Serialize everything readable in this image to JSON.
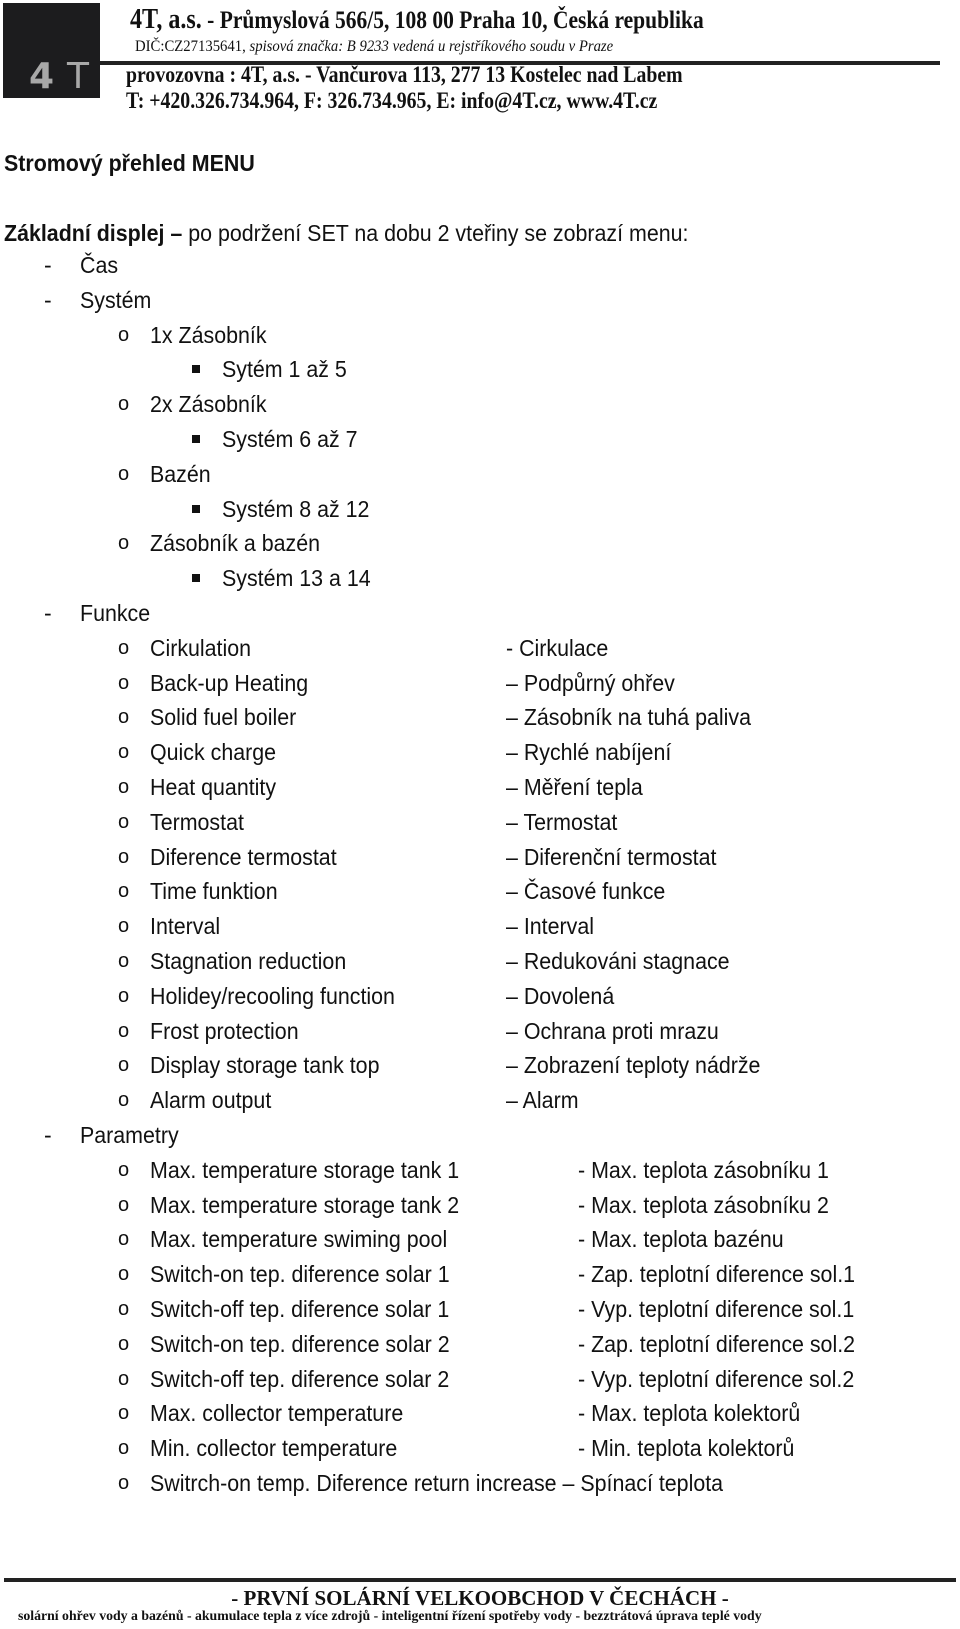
{
  "letterhead": {
    "logo_text_a": "4",
    "logo_text_b": "T",
    "company_bold": "4T, a.s.",
    "line1_rest": " - Průmyslová 566/5, 108 00 Praha 10, Česká republika",
    "line2_dic": "DIČ:CZ27135641, ",
    "line2_italic": "spisová značka: B 9233 vedená u rejstříkového soudu v Praze",
    "line3": "provozovna : 4T, a.s. - Vančurova 113, 277 13 Kostelec nad Labem",
    "line4": "T: +420.326.734.964, F: 326.734.965, E: info@4T.cz, www.4T.cz"
  },
  "document": {
    "title": "Stromový přehled MENU",
    "intro_bold": "Základní displej –",
    "intro_rest": " po podržení SET na dobu 2 vteřiny se zobrazí menu:",
    "menu": {
      "cas": {
        "bullet": "-",
        "label": "Čas"
      },
      "system": {
        "bullet": "-",
        "label": "Systém",
        "children": [
          {
            "bullet": "o",
            "label": "1x Zásobník",
            "sub": "Sytém 1 až 5"
          },
          {
            "bullet": "o",
            "label": "2x Zásobník",
            "sub": "Systém 6 až 7"
          },
          {
            "bullet": "o",
            "label": "Bazén",
            "sub": "Systém 8 až 12"
          },
          {
            "bullet": "o",
            "label": "Zásobník a bazén",
            "sub": "Systém 13 a 14"
          }
        ]
      },
      "funkce": {
        "bullet": "-",
        "label": "Funkce",
        "items": [
          {
            "bullet": "o",
            "en": "Cirkulation",
            "cz": "- Cirkulace"
          },
          {
            "bullet": "o",
            "en": "Back-up Heating",
            "cz": "– Podpůrný ohřev"
          },
          {
            "bullet": "o",
            "en": "Solid fuel boiler",
            "cz": "– Zásobník na tuhá paliva"
          },
          {
            "bullet": "o",
            "en": "Quick charge",
            "cz": "– Rychlé nabíjení"
          },
          {
            "bullet": "o",
            "en": "Heat quantity",
            "cz": "– Měření tepla"
          },
          {
            "bullet": "o",
            "en": "Termostat",
            "cz": "– Termostat"
          },
          {
            "bullet": "o",
            "en": "Diference termostat",
            "cz": "– Diferenční termostat"
          },
          {
            "bullet": "o",
            "en": "Time funktion",
            "cz": "– Časové funkce"
          },
          {
            "bullet": "o",
            "en": "Interval",
            "cz": "– Interval"
          },
          {
            "bullet": "o",
            "en": "Stagnation reduction",
            "cz": "– Redukováni stagnace"
          },
          {
            "bullet": "o",
            "en": "Holidey/recooling function",
            "cz": "– Dovolená"
          },
          {
            "bullet": "o",
            "en": "Frost protection",
            "cz": "– Ochrana proti mrazu"
          },
          {
            "bullet": "o",
            "en": "Display storage tank top",
            "cz": "– Zobrazení teploty nádrže"
          },
          {
            "bullet": "o",
            "en": "Alarm output",
            "cz": "– Alarm"
          }
        ]
      },
      "parametry": {
        "bullet": "-",
        "label": "Parametry",
        "items": [
          {
            "bullet": "o",
            "en": "Max. temperature storage tank 1",
            "cz": "- Max. teplota zásobníku 1"
          },
          {
            "bullet": "o",
            "en": "Max. temperature storage tank 2",
            "cz": "- Max. teplota zásobníku 2"
          },
          {
            "bullet": "o",
            "en": "Max. temperature swiming pool",
            "cz": "- Max. teplota bazénu"
          },
          {
            "bullet": "o",
            "en": "Switch-on tep. diference solar 1",
            "cz": "- Zap. teplotní diference sol.1"
          },
          {
            "bullet": "o",
            "en": "Switch-off tep. diference solar 1",
            "cz": "- Vyp. teplotní diference sol.1"
          },
          {
            "bullet": "o",
            "en": "Switch-on tep. diference solar 2",
            "cz": "- Zap. teplotní diference sol.2"
          },
          {
            "bullet": "o",
            "en": "Switch-off tep. diference solar 2",
            "cz": "- Vyp. teplotní diference sol.2"
          },
          {
            "bullet": "o",
            "en": "Max. collector temperature",
            "cz": "- Max. teplota kolektorů"
          },
          {
            "bullet": "o",
            "en": "Min. collector temperature",
            "cz": "- Min. teplota kolektorů"
          },
          {
            "bullet": "o",
            "en": "Switrch-on temp. Diference return increase – Spínací teplota",
            "cz": ""
          }
        ]
      }
    }
  },
  "footer": {
    "slogan": "- PRVNÍ SOLÁRNÍ VELKOOBCHOD V ČECHÁCH -",
    "services": "solární ohřev vody a bazénů - akumulace tepla z více zdrojů - inteligentní řízení spotřeby vody - bezztrátová úprava teplé vody"
  }
}
